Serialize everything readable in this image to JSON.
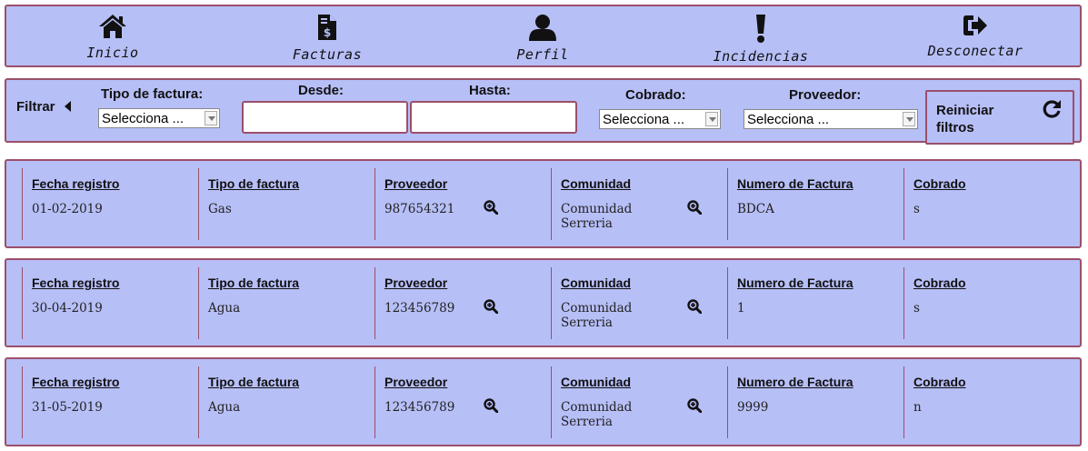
{
  "nav": {
    "items": [
      {
        "label": "Inicio",
        "icon": "home-icon"
      },
      {
        "label": "Facturas",
        "icon": "invoice-icon"
      },
      {
        "label": "Perfil",
        "icon": "user-icon"
      },
      {
        "label": "Incidencias",
        "icon": "exclamation-icon"
      },
      {
        "label": "Desconectar",
        "icon": "sign-out-icon"
      }
    ]
  },
  "filters": {
    "toggle_label": "Filtrar",
    "tipo_label": "Tipo de factura:",
    "tipo_value": "Selecciona ...",
    "desde_label": "Desde:",
    "desde_value": "",
    "hasta_label": "Hasta:",
    "hasta_value": "",
    "cobrado_label": "Cobrado:",
    "cobrado_value": "Selecciona ...",
    "proveedor_label": "Proveedor:",
    "proveedor_value": "Selecciona ...",
    "reset_label": "Reiniciar filtros",
    "reset_icon": "redo-icon"
  },
  "columns": {
    "fecha": "Fecha registro",
    "tipo": "Tipo de factura",
    "proveedor": "Proveedor",
    "comunidad": "Comunidad",
    "numero": "Numero de Factura",
    "cobrado": "Cobrado"
  },
  "records": [
    {
      "fecha": "01-02-2019",
      "tipo": "Gas",
      "proveedor": "987654321",
      "comunidad": "Comunidad Serreria",
      "numero": "BDCA",
      "cobrado": "s"
    },
    {
      "fecha": "30-04-2019",
      "tipo": "Agua",
      "proveedor": "123456789",
      "comunidad": "Comunidad Serreria",
      "numero": "1",
      "cobrado": "s"
    },
    {
      "fecha": "31-05-2019",
      "tipo": "Agua",
      "proveedor": "123456789",
      "comunidad": "Comunidad Serreria",
      "numero": "9999",
      "cobrado": "n"
    }
  ],
  "colors": {
    "panel": "#b7bff7",
    "border": "#9b4f6a"
  }
}
